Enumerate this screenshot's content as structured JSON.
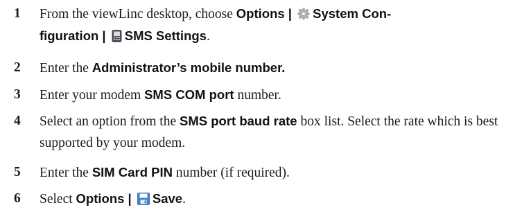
{
  "steps": [
    {
      "number": "1",
      "parts": {
        "t1": "From the viewLinc desktop, choose ",
        "b1": "Options | ",
        "b2": "System Con-",
        "b3": "figuration | ",
        "b4": "SMS Settings",
        "t2": "."
      },
      "icons": [
        "gear-icon",
        "sms-phone-icon"
      ]
    },
    {
      "number": "2",
      "parts": {
        "t1": "Enter the ",
        "b1": "Administrator’s mobile number."
      }
    },
    {
      "number": "3",
      "parts": {
        "t1": "Enter your modem ",
        "b1": "SMS COM port",
        "t2": " number."
      }
    },
    {
      "number": "4",
      "parts": {
        "t1": "Select an option from the ",
        "b1": "SMS port baud rate",
        "t2": " box list. Select the rate which is best supported by your modem."
      }
    },
    {
      "number": "5",
      "parts": {
        "t1": "Enter the ",
        "b1": "SIM Card PIN",
        "t2": " number (if required)."
      }
    },
    {
      "number": "6",
      "parts": {
        "t1": "Select ",
        "b1": "Options | ",
        "b2": "Save",
        "t2": "."
      },
      "icons": [
        "save-disk-icon"
      ]
    }
  ]
}
